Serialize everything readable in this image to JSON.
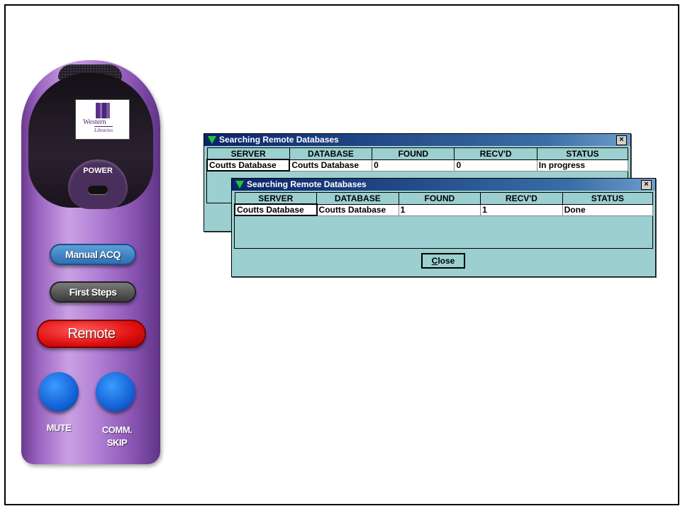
{
  "remote": {
    "logo_text": "Western",
    "logo_sub": "Libraries",
    "power_label": "POWER",
    "manual_acq_label": "Manual ACQ",
    "first_steps_label": "First Steps",
    "remote_label": "Remote",
    "mute_label": "MUTE",
    "comm_skip_label_line1": "COMM.",
    "comm_skip_label_line2": "SKIP",
    "colors": {
      "body": "#a874cf",
      "manual": "#3a7fc1",
      "remote": "#e01010",
      "round": "#1462d6"
    }
  },
  "back_dialog": {
    "title": "Searching Remote Databases",
    "close_glyph": "×",
    "columns": [
      "SERVER",
      "DATABASE",
      "FOUND",
      "RECV'D",
      "STATUS"
    ],
    "rows": [
      [
        "Coutts Database",
        "Coutts Database",
        "0",
        "0",
        "In progress"
      ]
    ]
  },
  "front_dialog": {
    "title": "Searching Remote Databases",
    "close_glyph": "×",
    "columns": [
      "SERVER",
      "DATABASE",
      "FOUND",
      "RECV'D",
      "STATUS"
    ],
    "rows": [
      [
        "Coutts Database",
        "Coutts Database",
        "1",
        "1",
        "Done"
      ]
    ],
    "close_button_mnemonic": "C",
    "close_button_rest": "lose"
  }
}
